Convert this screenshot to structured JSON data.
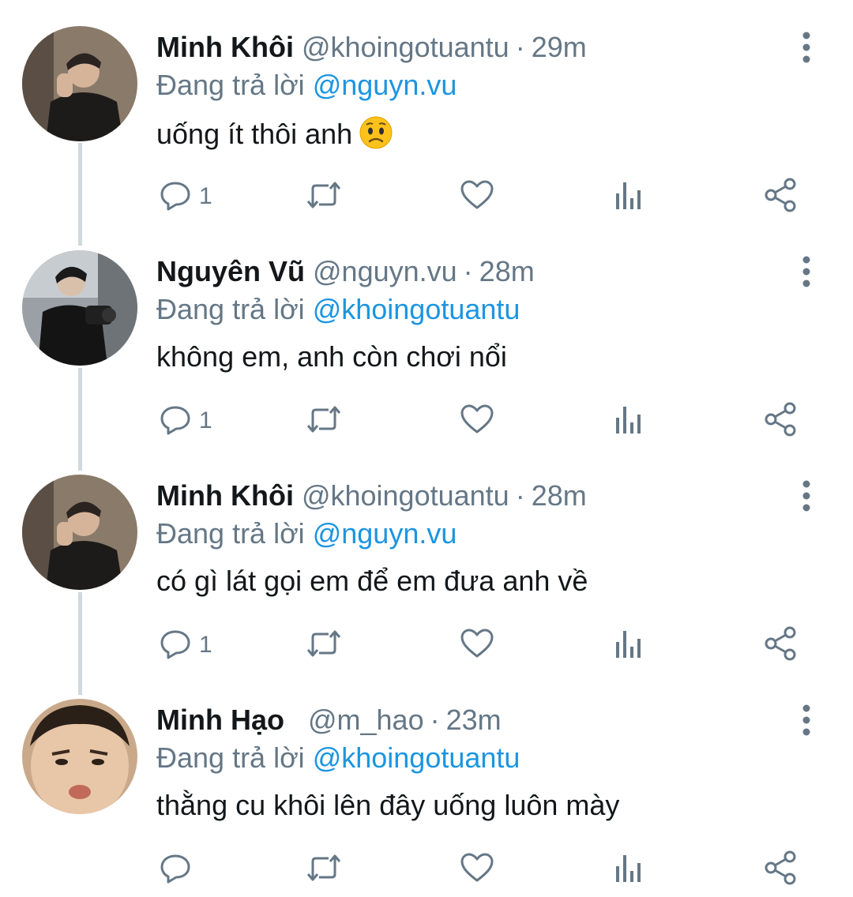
{
  "reply_prefix": "Đang trả lời",
  "colors": {
    "mention": "#1b95e0",
    "secondary_text": "#657786",
    "primary_text": "#14171a",
    "thread_line": "#cfd9de"
  },
  "tweets": [
    {
      "name": "Minh Khôi",
      "handle": "@khoingotuantu",
      "time": "29m",
      "reply_to": "@nguyn.vu",
      "text": "uống ít thôi anh",
      "emoji": "worried-face",
      "reply_count": "1"
    },
    {
      "name": "Nguyên Vũ",
      "handle": "@nguyn.vu",
      "time": "28m",
      "reply_to": "@khoingotuantu",
      "text": "không em, anh còn chơi nổi",
      "reply_count": "1"
    },
    {
      "name": "Minh Khôi",
      "handle": "@khoingotuantu",
      "time": "28m",
      "reply_to": "@nguyn.vu",
      "text": "có gì lát gọi em để em đưa anh về",
      "reply_count": "1"
    },
    {
      "name": "Minh Hạo",
      "handle": "@m_hao",
      "time": "23m",
      "reply_to": "@khoingotuantu",
      "text": "thằng cu khôi lên đây uống luôn mày",
      "reply_count": ""
    }
  ]
}
